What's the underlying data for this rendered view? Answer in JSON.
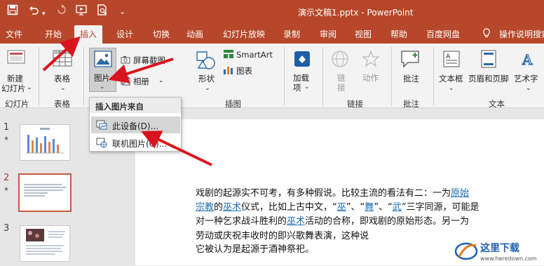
{
  "titlebar": {
    "document_title": "演示文稿1.pptx  -  PowerPoint"
  },
  "tabs": [
    {
      "label": "文件"
    },
    {
      "label": "开始"
    },
    {
      "label": "插入"
    },
    {
      "label": "设计"
    },
    {
      "label": "切换"
    },
    {
      "label": "动画"
    },
    {
      "label": "幻灯片放映"
    },
    {
      "label": "录制"
    },
    {
      "label": "审阅"
    },
    {
      "label": "视图"
    },
    {
      "label": "帮助"
    },
    {
      "label": "百度网盘"
    },
    {
      "label": "操作说明搜索"
    }
  ],
  "ribbon": {
    "new_slide": {
      "line1": "新建",
      "line2": "幻灯片"
    },
    "table": "表格",
    "picture": "图片",
    "screenshot": "屏幕截图",
    "album": "相册",
    "shapes": "形状",
    "smartart": "SmartArt",
    "chart": "图表",
    "addins": {
      "line1": "加载",
      "line2": "项"
    },
    "link": {
      "line1": "链",
      "line2": "接"
    },
    "action": "动作",
    "comment": "批注",
    "textbox": "文本框",
    "header_footer": "页眉和页脚",
    "wordart": "艺术字",
    "groups": {
      "slides": "幻灯片",
      "tables": "表格",
      "images": "插图",
      "links": "链接",
      "comments": "批注",
      "text": "文本"
    }
  },
  "dropdown": {
    "header": "插入图片来自",
    "items": [
      {
        "label": "此设备(D)..."
      },
      {
        "label": "联机图片(O)..."
      }
    ]
  },
  "slides": [
    {
      "number": "1"
    },
    {
      "number": "2"
    },
    {
      "number": "3"
    }
  ],
  "slide_text": {
    "l1_a": "戏剧的起源实不可考，有多种假说。比较主流的看法有二：一为",
    "l1_link": "原始",
    "l2_link1": "宗教",
    "l2_a": "的",
    "l2_link2": "巫术",
    "l2_b": "仪式，比如上古中文，“",
    "l2_link3": "巫",
    "l2_c": "”、“",
    "l2_link4": "舞",
    "l2_d": "”、“",
    "l2_link5": "武",
    "l2_e": "”三字同源，可能是",
    "l3_a": "对一种乞求战斗胜利的",
    "l3_link": "巫术",
    "l3_b": "活动的合称，即戏剧的原始形态。另一为",
    "l4": "劳动或庆祝丰收时的即兴歌舞表演，这种说",
    "l5": "它被认为是起源于酒神祭祀。"
  },
  "watermark": {
    "name": "这里下载",
    "url": "www.heredown.com"
  },
  "colors": {
    "accent": "#b7472a",
    "ribbon_bg": "#f3f3f3",
    "highlight": "#d5d5d5",
    "arrow": "#d9141e",
    "link": "#1f6fb2"
  }
}
